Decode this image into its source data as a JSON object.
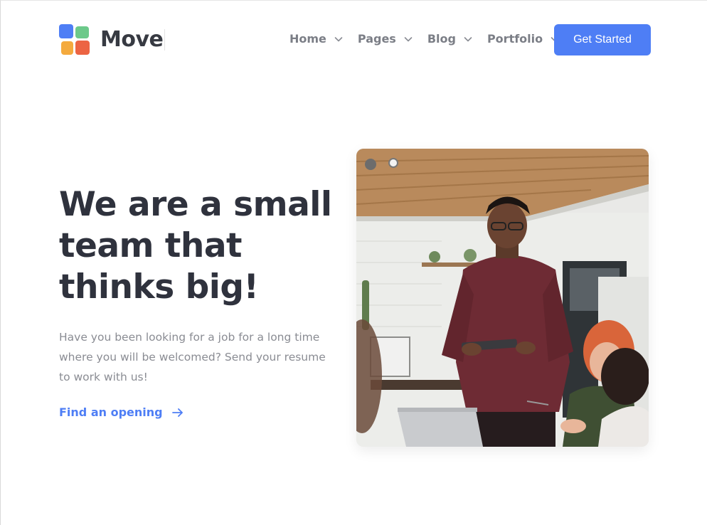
{
  "brand": {
    "name": "Move",
    "colors": {
      "blue": "#4e7ef5",
      "green": "#6cc98a",
      "orange": "#f4aa3e",
      "red": "#ec6443"
    }
  },
  "nav": {
    "items": [
      {
        "label": "Home",
        "icon": "chevron-down-icon"
      },
      {
        "label": "Pages",
        "icon": "chevron-down-icon"
      },
      {
        "label": "Blog",
        "icon": "chevron-down-icon"
      },
      {
        "label": "Portfolio",
        "icon": "chevron-down-icon"
      }
    ],
    "cta_label": "Get Started"
  },
  "hero": {
    "title": "We are a small team that thinks big!",
    "subtitle": "Have you been looking for a job for a long time where you will be welcomed? Send your resume to work with us!",
    "link_label": "Find an opening",
    "link_icon": "arrow-right-icon",
    "image_subject": "team-meeting-photo"
  },
  "colors": {
    "accent": "#4e7ef5",
    "heading": "#2f323d",
    "body_text": "#8a8c93",
    "nav_text": "#7b7e86"
  }
}
